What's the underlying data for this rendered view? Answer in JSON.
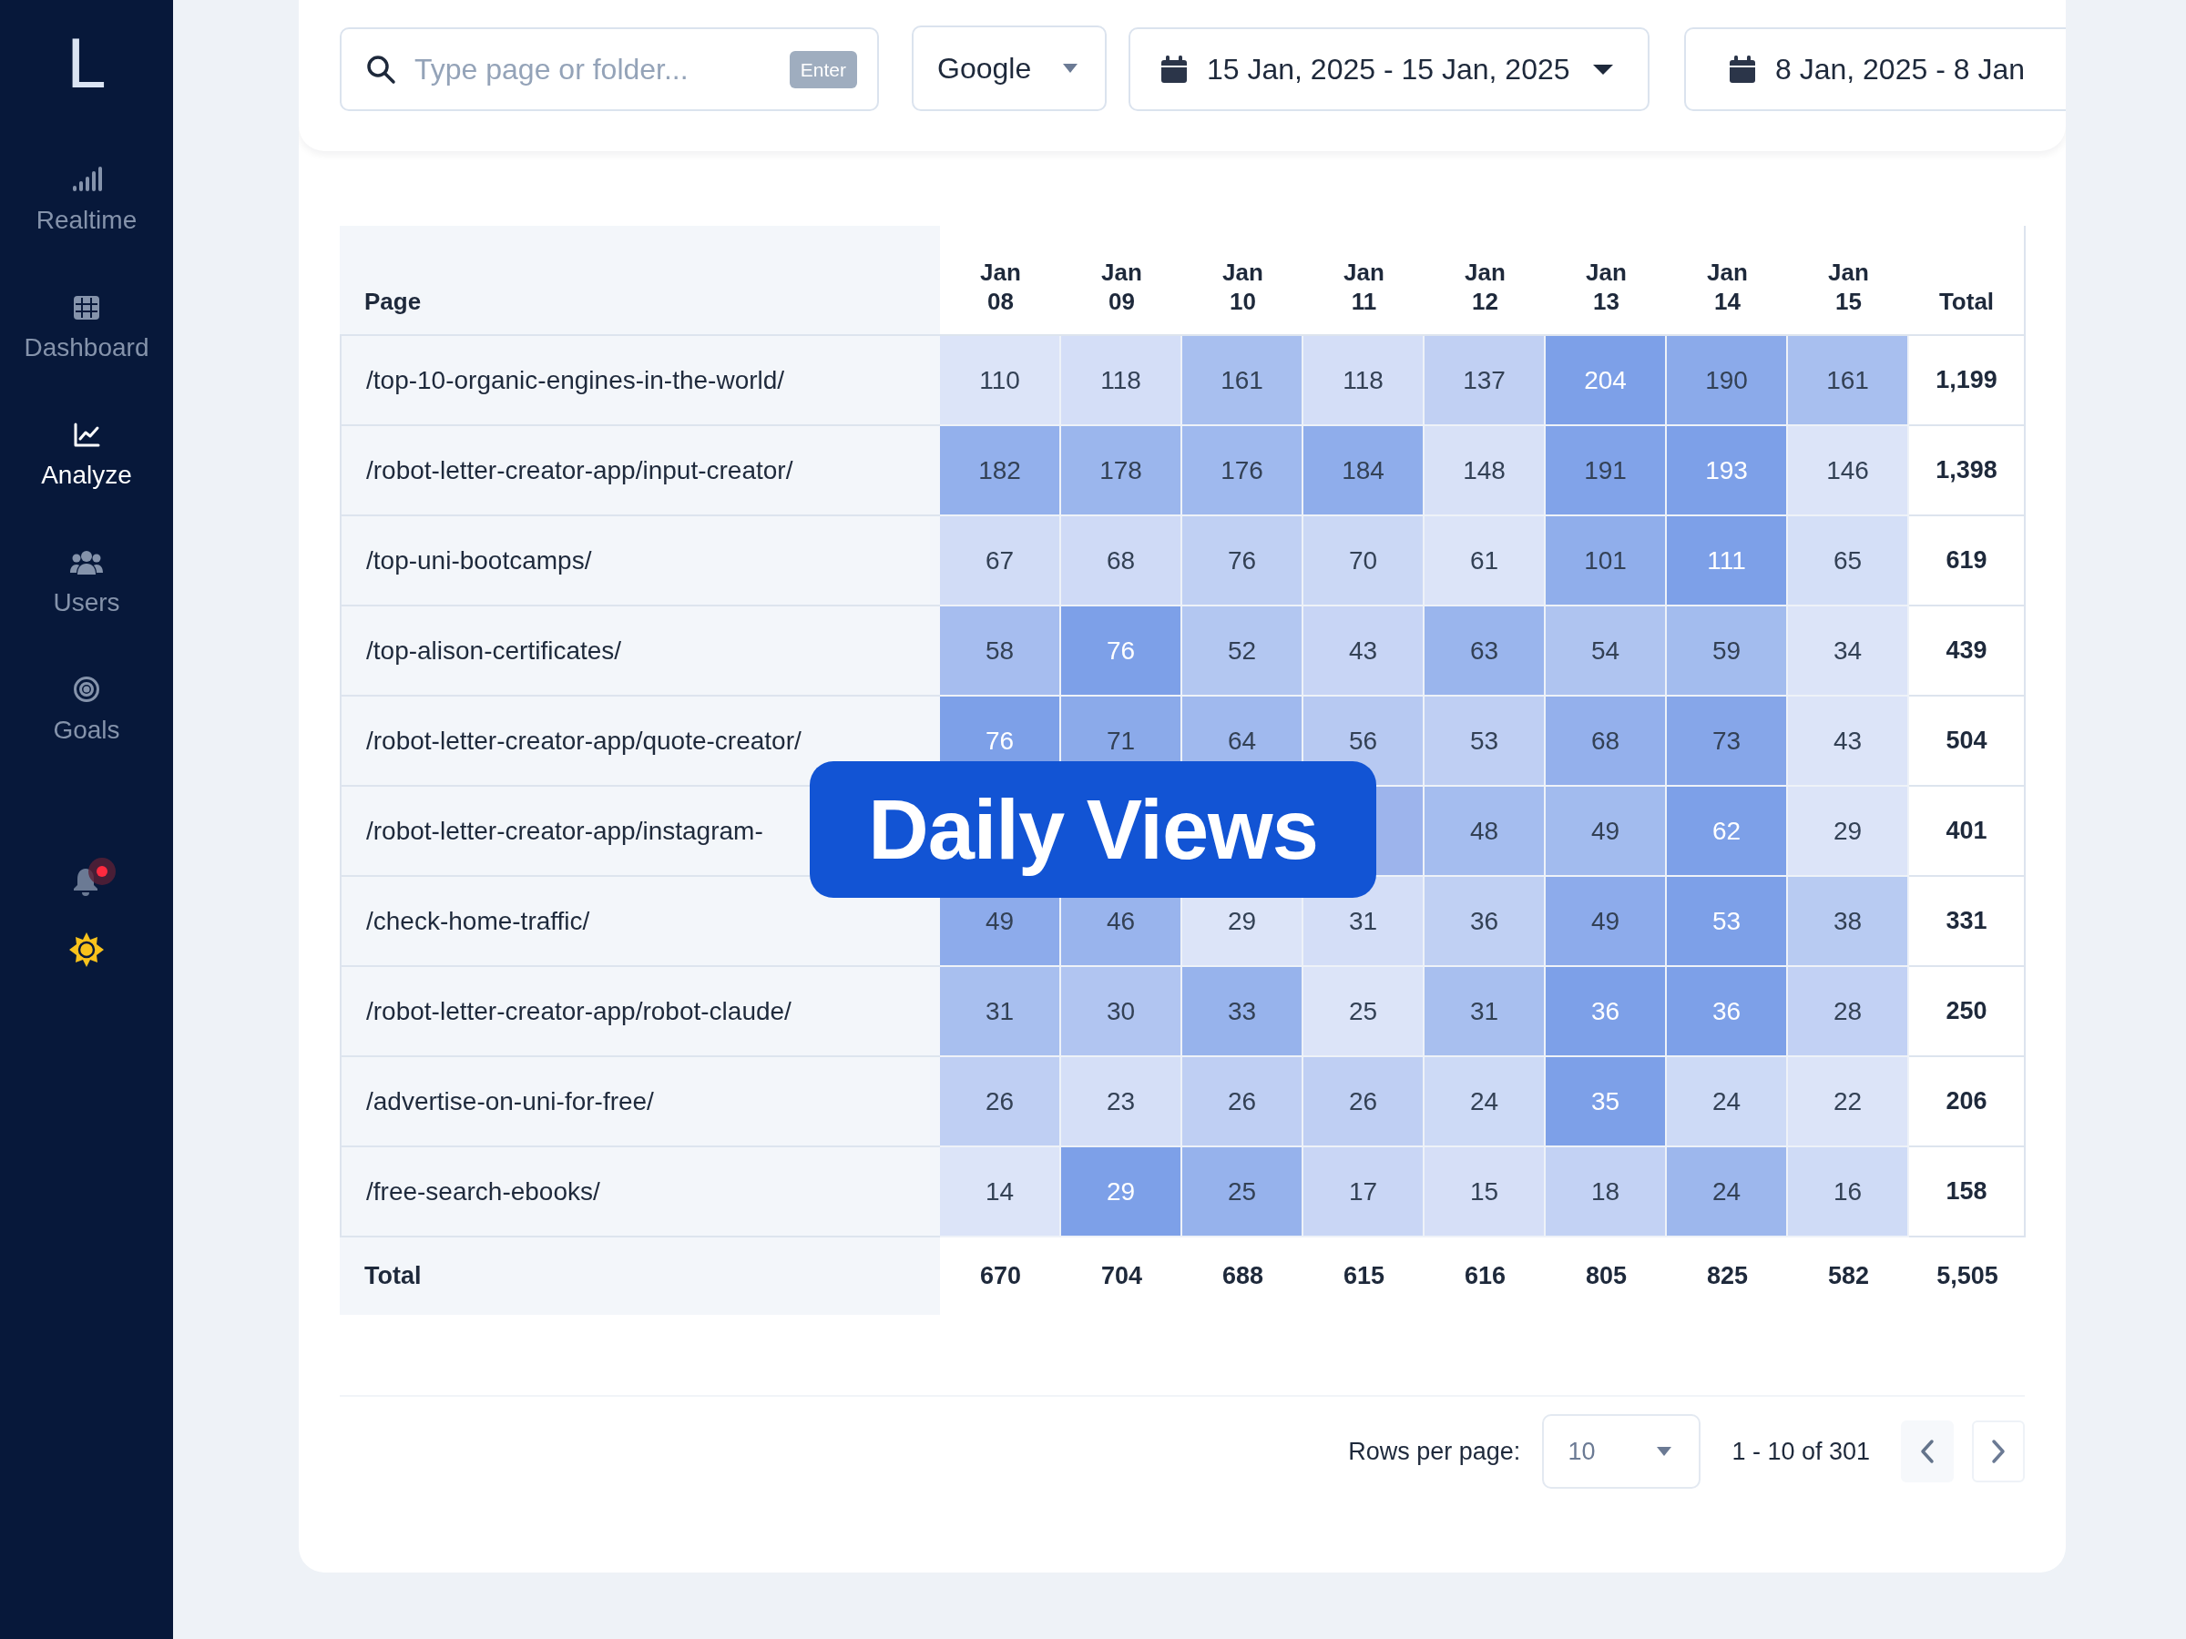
{
  "sidebar": {
    "logo": "L",
    "items": [
      {
        "label": "Realtime",
        "kind": "signal",
        "selected": false
      },
      {
        "label": "Dashboard",
        "kind": "grid",
        "selected": false
      },
      {
        "label": "Analyze",
        "kind": "chart",
        "selected": true
      },
      {
        "label": "Users",
        "kind": "users",
        "selected": false
      },
      {
        "label": "Goals",
        "kind": "target",
        "selected": false
      }
    ],
    "notifications": {
      "unread": true
    }
  },
  "toolbar": {
    "search": {
      "placeholder": "Type page or folder...",
      "key_hint": "Enter"
    },
    "source": "Google",
    "date_range": "15 Jan, 2025 - 15 Jan, 2025",
    "compare_range": "8 Jan, 2025 - 8 Jan"
  },
  "table": {
    "columns": [
      "Page",
      "Jan 08",
      "Jan 09",
      "Jan 10",
      "Jan 11",
      "Jan 12",
      "Jan 13",
      "Jan 14",
      "Jan 15",
      "Total"
    ],
    "rows": [
      {
        "page": "/top-10-organic-engines-in-the-world/",
        "values": [
          "110",
          "118",
          "161",
          "118",
          "137",
          "204",
          "190",
          "161"
        ],
        "total": "1,199"
      },
      {
        "page": "/robot-letter-creator-app/input-creator/",
        "values": [
          "182",
          "178",
          "176",
          "184",
          "148",
          "191",
          "193",
          "146"
        ],
        "total": "1,398"
      },
      {
        "page": "/top-uni-bootcamps/",
        "values": [
          "67",
          "68",
          "76",
          "70",
          "61",
          "101",
          "111",
          "65"
        ],
        "total": "619"
      },
      {
        "page": "/top-alison-certificates/",
        "values": [
          "58",
          "76",
          "52",
          "43",
          "63",
          "54",
          "59",
          "34"
        ],
        "total": "439"
      },
      {
        "page": "/robot-letter-creator-app/quote-creator/",
        "values": [
          "76",
          "71",
          "64",
          "56",
          "53",
          "68",
          "73",
          "43"
        ],
        "total": "504"
      },
      {
        "page": "/robot-letter-creator-app/instagram-",
        "values": [
          "48",
          "49",
          "62",
          "29"
        ],
        "total": "401"
      },
      {
        "page": "/check-home-traffic/",
        "values": [
          "49",
          "46",
          "29",
          "31",
          "36",
          "49",
          "53",
          "38"
        ],
        "total": "331"
      },
      {
        "page": "/robot-letter-creator-app/robot-claude/",
        "values": [
          "31",
          "30",
          "33",
          "25",
          "31",
          "36",
          "36",
          "28"
        ],
        "total": "250"
      },
      {
        "page": "/advertise-on-uni-for-free/",
        "values": [
          "26",
          "23",
          "26",
          "26",
          "24",
          "35",
          "24",
          "22"
        ],
        "total": "206"
      },
      {
        "page": "/free-search-ebooks/",
        "values": [
          "14",
          "29",
          "25",
          "17",
          "15",
          "18",
          "24",
          "16"
        ],
        "total": "158"
      }
    ],
    "totals": {
      "label": "Total",
      "values": [
        "670",
        "704",
        "688",
        "615",
        "616",
        "805",
        "825",
        "582"
      ],
      "total": "5,505"
    }
  },
  "pagination": {
    "rows_per_page_label": "Rows per page:",
    "rows_per_page": "10",
    "range": "1 - 10 of 301"
  },
  "overlay": {
    "title": "Daily Views"
  }
}
